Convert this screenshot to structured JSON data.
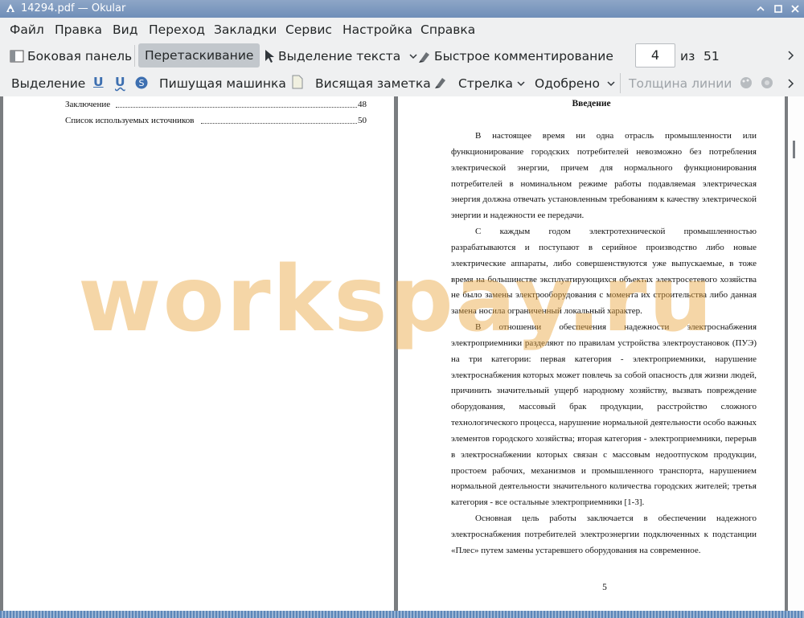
{
  "window": {
    "title": "14294.pdf — Okular"
  },
  "menubar": {
    "items": [
      "Файл",
      "Правка",
      "Вид",
      "Переход",
      "Закладки",
      "Сервис",
      "Настройка",
      "Справка"
    ]
  },
  "toolbar": {
    "sidebar": "Боковая панель",
    "browse": "Перетаскивание",
    "text_select": "Выделение текста",
    "quick_annotations": "Быстрое комментирование",
    "page_current": "4",
    "page_of": "из",
    "page_total": "51"
  },
  "annotbar": {
    "highlight": "Выделение",
    "typewriter": "Пишущая машинка",
    "popup_note": "Висящая заметка",
    "arrow": "Стрелка",
    "stamp": "Одобрено",
    "line_width": "Толщина линии"
  },
  "left_page": {
    "toc": [
      {
        "label": "Заключение",
        "page": "48"
      },
      {
        "label": "Список используемых источников",
        "page": "50"
      }
    ]
  },
  "right_page": {
    "heading": "Введение",
    "paragraphs": [
      "В настоящее время ни одна отрасль промышленности или функционирование городских потребителей невозможно без потребления электрической энергии, причем для нормального функционирования потребителей в номинальном режиме работы подавляемая электрическая энергия должна отвечать установленным требованиям к качеству электрической энергии и надежности ее передачи.",
      "С каждым годом электротехнической промышленностью разрабатываются и поступают в серийное производство либо новые электрические аппараты, либо совершенствуются уже выпускаемые, в тоже время на большинстве эксплуатирующихся объектах электросетевого хозяйства не было замены электрооборудования с момента их строительства либо данная замена носила ограниченный локальный характер.",
      "В отношении обеспечения надежности электроснабжения электроприемники разделяют по правилам устройства электроустановок (ПУЭ) на три категории: первая категория - электроприемники, нарушение электроснабжения которых может повлечь за собой опасность для жизни людей, причинить значительный ущерб народному хозяйству, вызвать повреждение оборудования, массовый брак продукции, расстройство сложного технологического процесса, нарушение нормальной деятельности особо важных элементов городского хозяйства; вторая категория - электроприемники, перерыв в электроснабжении которых связан с массовым недоотпуском продукции, простоем рабочих, механизмов и промышленного транспорта, нарушением нормальной деятельности значительного количества городских жителей; третья категория - все остальные электроприемники [1-3].",
      "Основная цель работы заключается в обеспечении надежного электроснабжения потребителей электроэнергии подключенных к подстанции «Плес» путем замены устаревшего оборудования на современное."
    ],
    "page_number": "5"
  },
  "watermark": "workspay.ru"
}
